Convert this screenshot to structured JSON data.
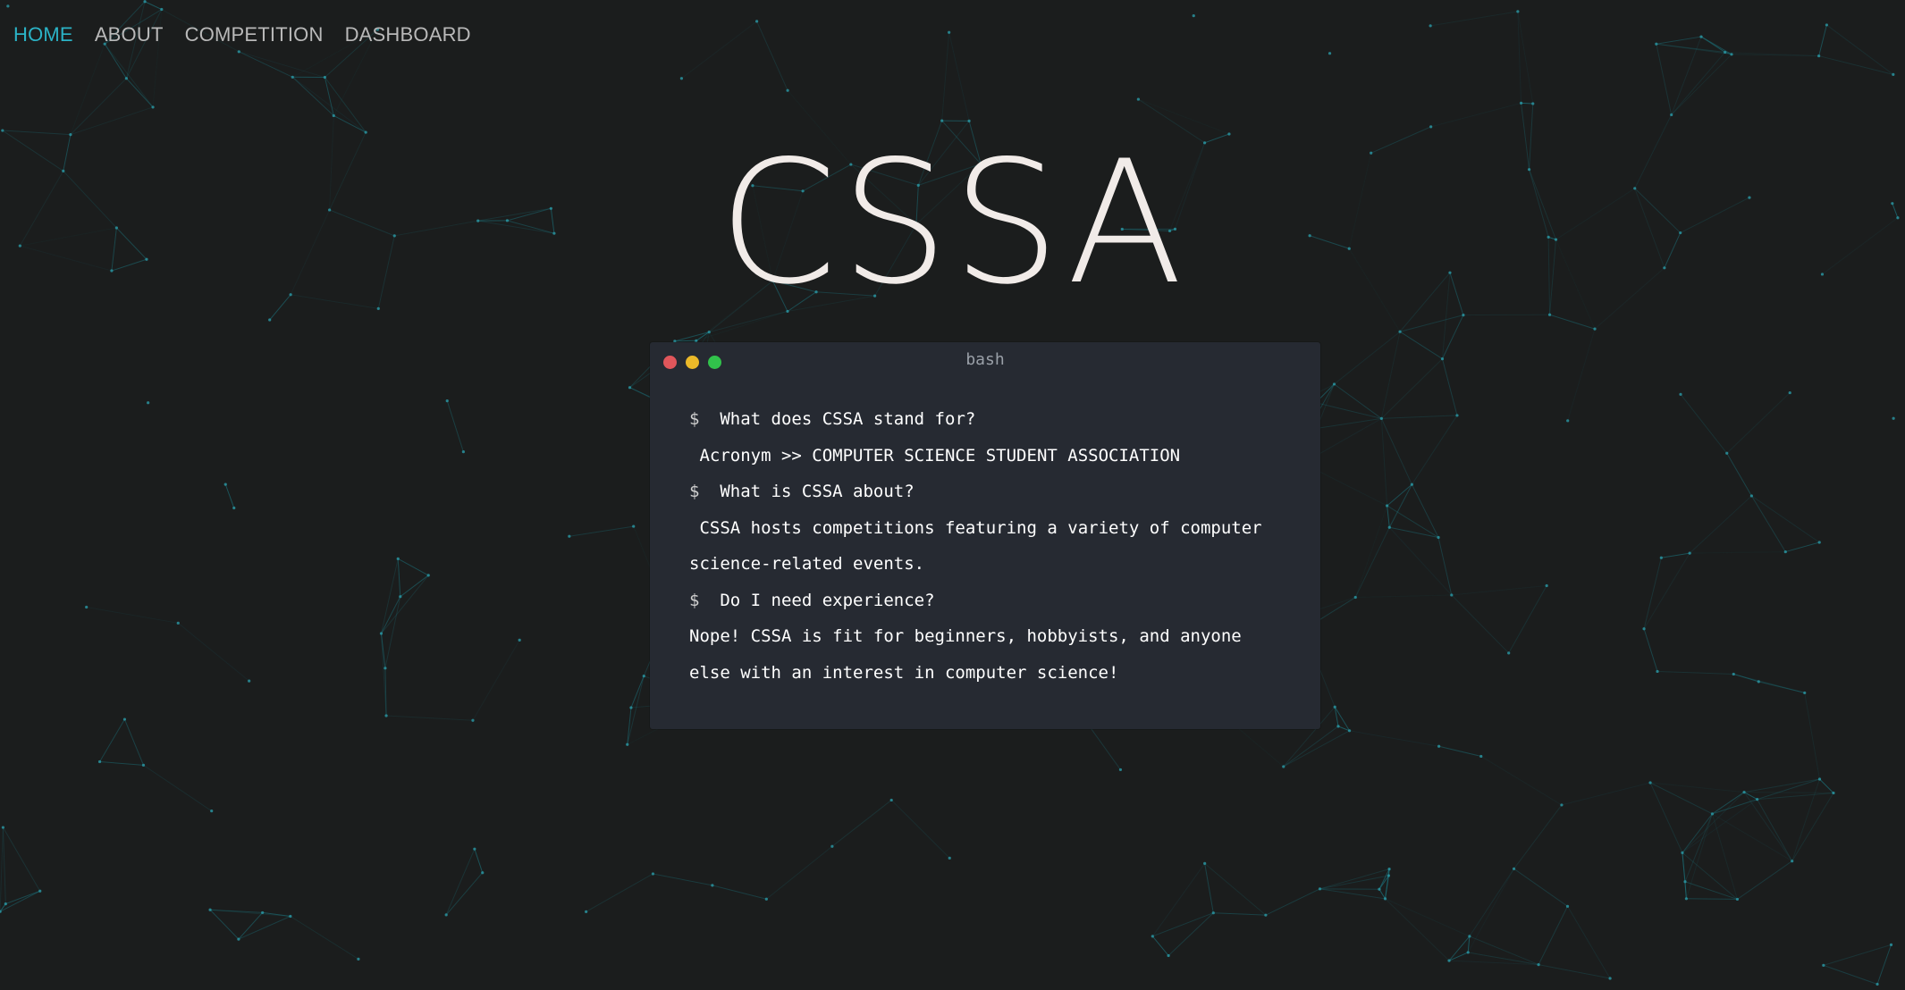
{
  "nav": {
    "items": [
      {
        "label": "HOME",
        "active": true
      },
      {
        "label": "ABOUT",
        "active": false
      },
      {
        "label": "COMPETITION",
        "active": false
      },
      {
        "label": "DASHBOARD",
        "active": false
      }
    ]
  },
  "hero": {
    "title": "CSSA"
  },
  "terminal": {
    "title": "bash",
    "prompt_symbol": "$",
    "lines": [
      {
        "type": "command",
        "text": "What does CSSA stand for?"
      },
      {
        "type": "output",
        "text": " Acronym >> COMPUTER SCIENCE STUDENT ASSOCIATION"
      },
      {
        "type": "command",
        "text": "What is CSSA about?"
      },
      {
        "type": "output",
        "text": " CSSA hosts competitions featuring a variety of computer science-related events."
      },
      {
        "type": "command",
        "text": "Do I need experience?"
      },
      {
        "type": "output",
        "text": "Nope! CSSA is fit for beginners, hobbyists, and anyone else with an interest in computer science!"
      }
    ]
  },
  "colors": {
    "background": "#1b1d1d",
    "accent": "#2bb3c6",
    "nav_text": "#b9b9b9",
    "title": "#f1ebe8",
    "terminal_bg": "#262a32",
    "network_line": "#1c6f78",
    "dot_red": "#e0565b",
    "dot_yellow": "#ebb929",
    "dot_green": "#31c24b"
  }
}
